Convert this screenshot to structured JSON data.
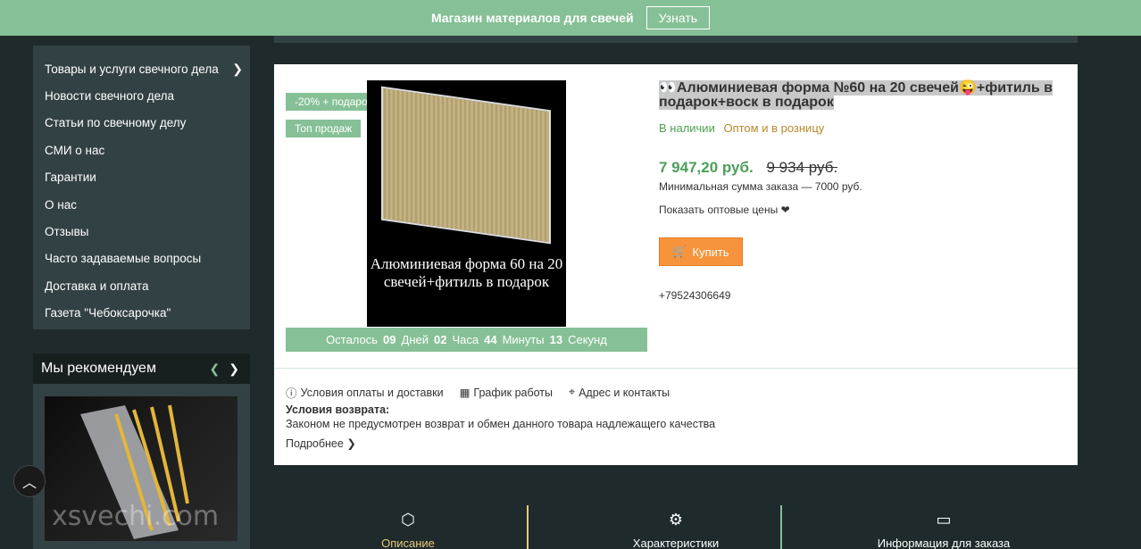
{
  "banner": {
    "text": "Магазин материалов для свечей",
    "button": "Узнать"
  },
  "sidebar": {
    "items": [
      {
        "label": "Товары и услуги свечного дела",
        "has_arrow": true
      },
      {
        "label": "Новости свечного дела"
      },
      {
        "label": "Статьи по свечному делу"
      },
      {
        "label": "СМИ о нас"
      },
      {
        "label": "Гарантии"
      },
      {
        "label": "О нас"
      },
      {
        "label": "Отзывы"
      },
      {
        "label": "Часто задаваемые вопросы"
      },
      {
        "label": "Доставка и оплата"
      },
      {
        "label": "Газета \"Чебоксарочка\""
      }
    ]
  },
  "recommend": {
    "title": "Мы рекомендуем",
    "watermark": "xsvechi.com"
  },
  "product": {
    "badges": [
      "-20% + подарок",
      "Топ продаж"
    ],
    "image_caption": "Алюминиевая форма 60 на 20 свечей+фитиль в подарок",
    "title": "👀Алюминиевая форма №60 на 20 свечей😜+фитиль в подарок+воск в подарок",
    "in_stock": "В наличии",
    "wholesale": "Оптом и в розницу",
    "price": "7 947,20 руб.",
    "old_price": "9 934 руб.",
    "min_order": "Минимальная сумма заказа — 7000 руб.",
    "show_wholesale": "Показать оптовые цены",
    "buy": "Купить",
    "phone": "+79524306649",
    "timer": {
      "prefix": "Осталось",
      "days": "09",
      "days_label": "Дней",
      "hours": "02",
      "hours_label": "Часа",
      "minutes": "44",
      "minutes_label": "Минуты",
      "seconds": "13",
      "seconds_label": "Секунд"
    }
  },
  "info": {
    "links": [
      "Условия оплаты и доставки",
      "График работы",
      "Адрес и контакты"
    ],
    "return_title": "Условия возврата:",
    "return_text": "Законом не предусмотрен возврат и обмен данного товара надлежащего качества",
    "more": "Подробнее"
  },
  "tabs": [
    {
      "label": "Описание",
      "icon": "box-icon",
      "active": true
    },
    {
      "label": "Характеристики",
      "icon": "gear-icon"
    },
    {
      "label": "Информация для заказа",
      "icon": "wallet-icon"
    }
  ]
}
